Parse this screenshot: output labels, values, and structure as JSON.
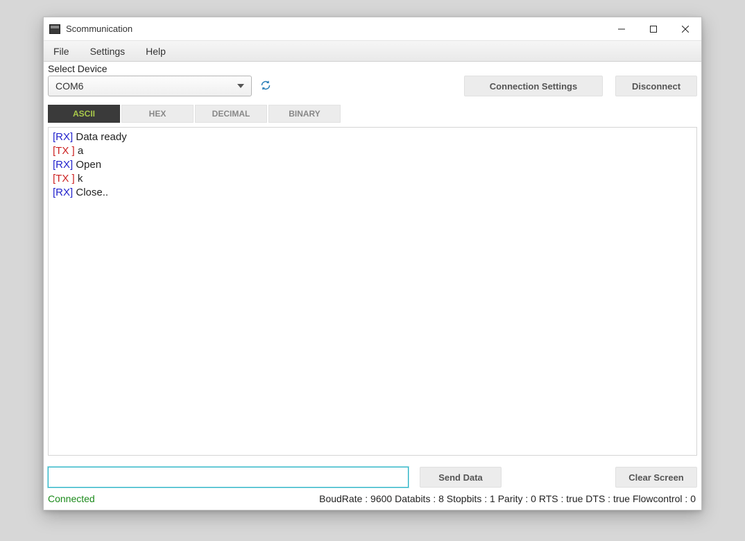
{
  "window": {
    "title": "Scommunication"
  },
  "menu": {
    "file": "File",
    "settings": "Settings",
    "help": "Help"
  },
  "device": {
    "label": "Select Device",
    "selected": "COM6"
  },
  "buttons": {
    "connection_settings": "Connection Settings",
    "disconnect": "Disconnect",
    "send_data": "Send Data",
    "clear_screen": "Clear Screen"
  },
  "tabs": [
    {
      "label": "ASCII",
      "active": true
    },
    {
      "label": "HEX",
      "active": false
    },
    {
      "label": "DECIMAL",
      "active": false
    },
    {
      "label": "BINARY",
      "active": false
    }
  ],
  "log": [
    {
      "tag": "[RX]",
      "kind": "rx",
      "message": " Data ready"
    },
    {
      "tag": "[TX ]",
      "kind": "tx",
      "message": " a"
    },
    {
      "tag": "[RX]",
      "kind": "rx",
      "message": " Open"
    },
    {
      "tag": "[TX ]",
      "kind": "tx",
      "message": " k"
    },
    {
      "tag": "[RX]",
      "kind": "rx",
      "message": " Close.."
    }
  ],
  "input": {
    "value": ""
  },
  "status": {
    "connection": "Connected",
    "info": "BoudRate : 9600 Databits : 8 Stopbits : 1 Parity : 0 RTS : true DTS : true Flowcontrol : 0"
  }
}
